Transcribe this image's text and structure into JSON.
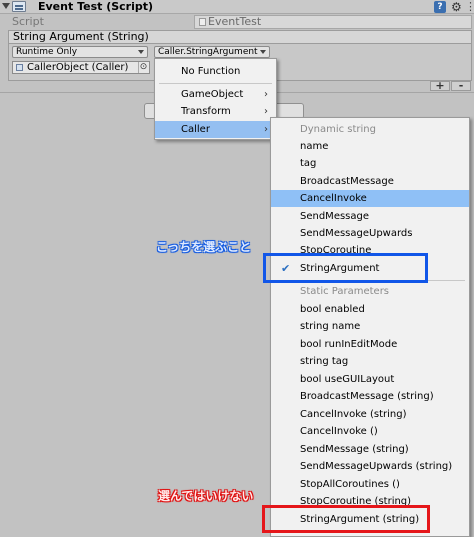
{
  "component": {
    "title": "Event Test (Script)",
    "script_label": "Script",
    "script_value": "EventTest",
    "help_glyph": "?",
    "settings_glyph": "⚙"
  },
  "event": {
    "header": "String Argument (String)",
    "runtime_dropdown": "Runtime Only",
    "function_dropdown": "Caller.StringArgument",
    "object_field": "CallerObject (Caller)",
    "target_glyph": "⊙",
    "plus_label": "+",
    "minus_label": "-"
  },
  "menu1": {
    "items": [
      {
        "label": "No Function",
        "has_submenu": false
      },
      {
        "label": "GameObject",
        "has_submenu": true
      },
      {
        "label": "Transform",
        "has_submenu": true
      },
      {
        "label": "Caller",
        "has_submenu": true,
        "highlighted": true
      }
    ],
    "submenu_glyph": "›"
  },
  "menu2": {
    "dynamic_header": "Dynamic string",
    "dynamic_items": [
      "name",
      "tag",
      "BroadcastMessage",
      "CancelInvoke",
      "SendMessage",
      "SendMessageUpwards",
      "StopCoroutine",
      "StringArgument"
    ],
    "static_header": "Static Parameters",
    "static_items": [
      "bool enabled",
      "string name",
      "bool runInEditMode",
      "string tag",
      "bool useGUILayout",
      "BroadcastMessage (string)",
      "CancelInvoke (string)",
      "CancelInvoke ()",
      "SendMessage (string)",
      "SendMessageUpwards (string)",
      "StopAllCoroutines ()",
      "StopCoroutine (string)",
      "StringArgument (string)"
    ],
    "checked_item": "StringArgument",
    "hovered_item": "CancelInvoke",
    "check_glyph": "✔"
  },
  "annotations": {
    "choose_this": "こっちを選ぶこと",
    "dont_choose": "選んではいけない"
  },
  "colors": {
    "highlight": "#94bff1",
    "annotation_blue": "#1156e8",
    "annotation_red": "#e5161a"
  }
}
